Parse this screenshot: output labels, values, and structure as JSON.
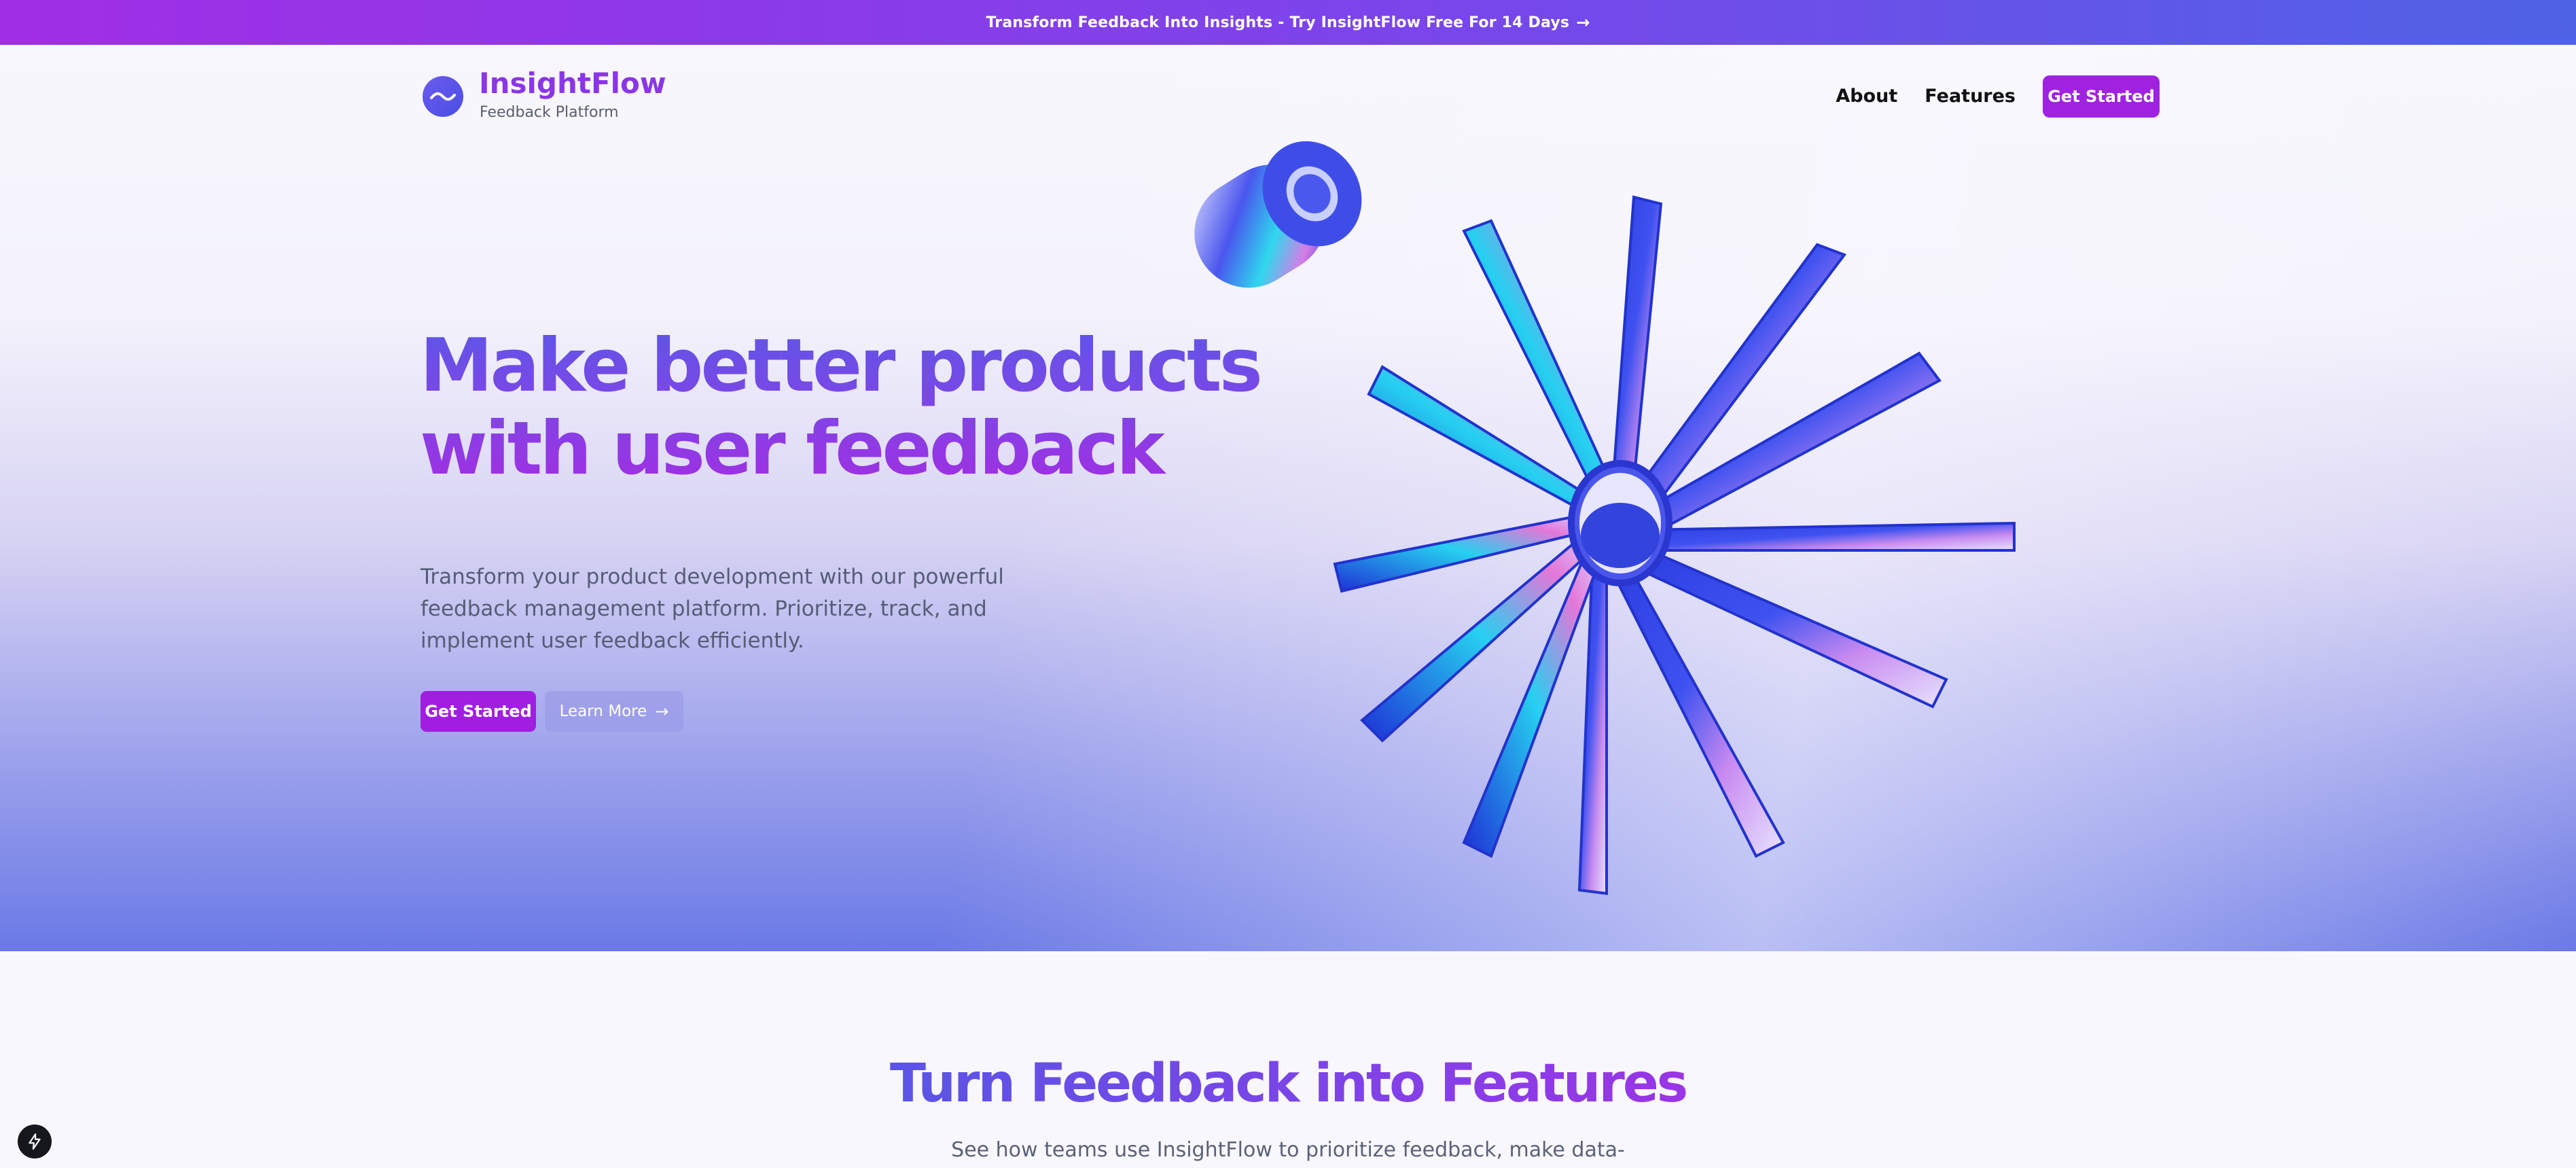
{
  "announcement": {
    "text": "Transform Feedback Into Insights - Try InsightFlow Free For 14 Days",
    "arrow_icon": "arrow-right-icon"
  },
  "header": {
    "brand_name": "InsightFlow",
    "brand_tagline": "Feedback Platform",
    "logo_icon": "wave-logo-icon",
    "nav": [
      {
        "label": "About"
      },
      {
        "label": "Features"
      }
    ],
    "cta_label": "Get Started"
  },
  "hero": {
    "title_line1": "Make better products",
    "title_line2": "with user feedback",
    "description": "Transform your product development with our powerful feedback management platform. Prioritize, track, and implement user feedback efficiently.",
    "primary_button": "Get Started",
    "secondary_button": "Learn More",
    "illustration_icon": "iridescent-starburst-icon"
  },
  "features": {
    "title": "Turn Feedback into Features",
    "subtitle": "See how teams use InsightFlow to prioritize feedback, make data-"
  },
  "colors": {
    "accent_purple": "#a022e0",
    "brand_purple": "#8b35e8",
    "brand_blue": "#5e55e6",
    "hero_gradient_bottom": "#6a79e6"
  }
}
